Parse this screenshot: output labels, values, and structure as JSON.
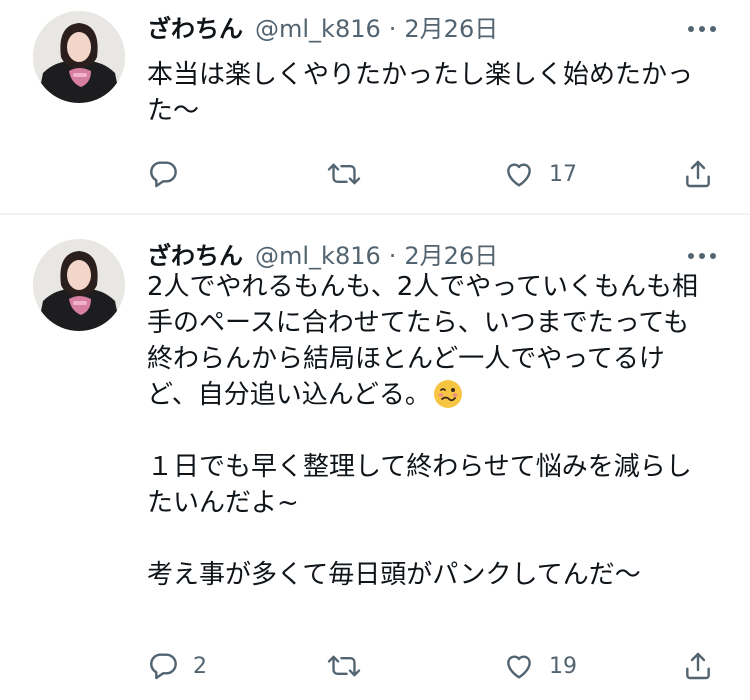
{
  "tweets": [
    {
      "display_name": "ざわちん",
      "handle": "@ml_k816",
      "separator": "·",
      "date": "2月26日",
      "text_lines": [
        "本当は楽しくやりたかったし楽しく始めたかっ",
        "た〜"
      ],
      "reply_count": "",
      "retweet_count": "",
      "like_count": "17"
    },
    {
      "display_name": "ざわちん",
      "handle": "@ml_k816",
      "separator": "·",
      "date": "2月26日",
      "text_lines": [
        "2人でやれるもんも、2人でやっていくもんも相",
        "手のペースに合わせてたら、いつまでたっても",
        "終わらんから結局ほとんど一人でやってるけ",
        "ど、自分追い込んどる。",
        "",
        "１日でも早く整理して終わらせて悩みを減らし",
        "たいんだよ~",
        "",
        "考え事が多くて毎日頭がパンクしてんだ〜"
      ],
      "emoji": "woozy-face-emoji",
      "reply_count": "2",
      "retweet_count": "",
      "like_count": "19"
    }
  ],
  "icons": {
    "more": "more-horizontal-icon",
    "reply": "reply-icon",
    "retweet": "retweet-icon",
    "like": "heart-icon",
    "share": "share-icon"
  },
  "colors": {
    "text_primary": "#0f1419",
    "text_secondary": "#536471",
    "divider": "#eff3f4",
    "emoji_face": "#f6c544"
  }
}
